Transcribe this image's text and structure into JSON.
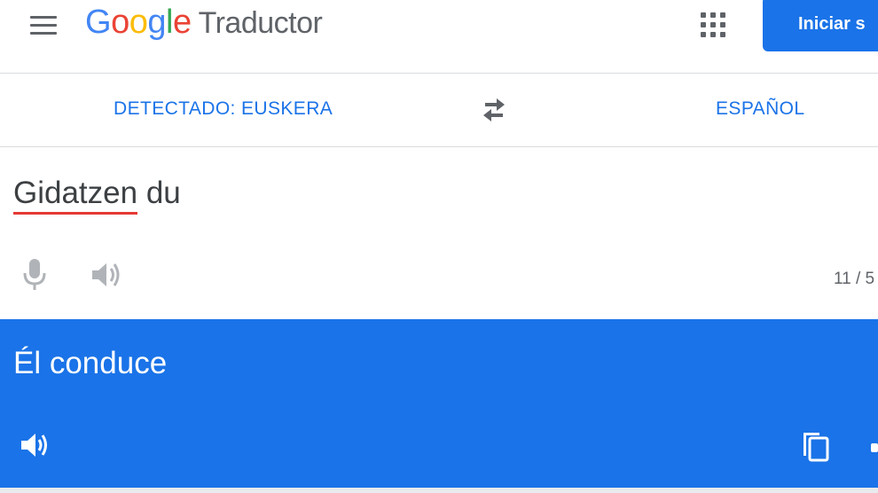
{
  "header": {
    "logo_letters": [
      {
        "char": "G",
        "color": "#4285f4"
      },
      {
        "char": "o",
        "color": "#ea4335"
      },
      {
        "char": "o",
        "color": "#fbbc05"
      },
      {
        "char": "g",
        "color": "#4285f4"
      },
      {
        "char": "l",
        "color": "#34a853"
      },
      {
        "char": "e",
        "color": "#ea4335"
      }
    ],
    "product_name": "Traductor",
    "menu_icon": "hamburger-menu-icon",
    "apps_icon": "apps-grid-icon",
    "signin_label": "Iniciar s"
  },
  "languages": {
    "source_label": "DETECTADO: EUSKERA",
    "target_label": "ESPAÑOL",
    "swap_icon": "swap-arrows-icon"
  },
  "source": {
    "text_word1": "Gidatzen",
    "text_word2": "du",
    "char_count": "11 / 5",
    "mic_icon": "microphone-icon",
    "listen_icon": "speaker-icon"
  },
  "result": {
    "text": "Él conduce",
    "listen_icon": "speaker-icon",
    "copy_icon": "copy-icon"
  },
  "colors": {
    "accent": "#1a73e8",
    "grey_text": "#5f6368",
    "spell_error": "#e53935"
  }
}
